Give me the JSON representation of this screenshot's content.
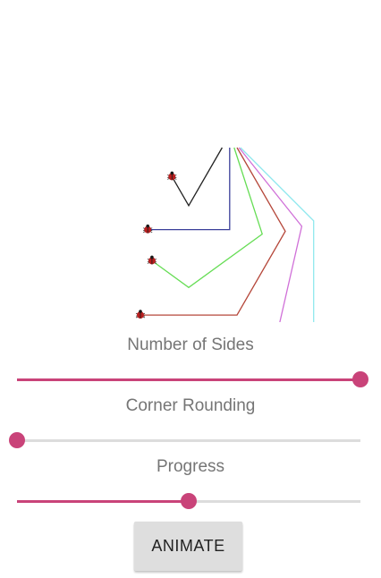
{
  "polygons": {
    "progress_fraction": 0.5,
    "series": [
      {
        "sides": 3,
        "color": "#222222"
      },
      {
        "sides": 4,
        "color": "#3b3f9a"
      },
      {
        "sides": 5,
        "color": "#66dd55"
      },
      {
        "sides": 6,
        "color": "#b5473a"
      },
      {
        "sides": 7,
        "color": "#d070d8"
      },
      {
        "sides": 8,
        "color": "#8fe8ee"
      }
    ],
    "icons": [
      "ladybug-icon"
    ]
  },
  "controls": {
    "sides_label": "Number of Sides",
    "sides_value": 1.0,
    "rounding_label": "Corner Rounding",
    "rounding_value": 0.0,
    "progress_label": "Progress",
    "progress_value": 0.5,
    "accent_color": "#c94379"
  },
  "button": {
    "animate_label": "ANIMATE"
  }
}
